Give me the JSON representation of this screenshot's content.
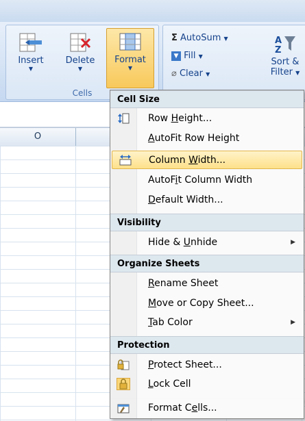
{
  "ribbon": {
    "cells_group": {
      "label": "Cells",
      "buttons": [
        {
          "label": "Insert",
          "icon": "insert-cells-icon"
        },
        {
          "label": "Delete",
          "icon": "delete-cells-icon"
        },
        {
          "label": "Format",
          "icon": "format-cells-icon"
        }
      ]
    },
    "editing_group": {
      "autosum": "AutoSum",
      "fill": "Fill",
      "clear": "Clear",
      "sort_line1": "Sort &",
      "sort_line2": "Filter"
    }
  },
  "sheet": {
    "column_header": "O"
  },
  "menu": {
    "sections": {
      "cell_size": "Cell Size",
      "visibility": "Visibility",
      "organize": "Organize Sheets",
      "protection": "Protection"
    },
    "items": {
      "row_height": {
        "pre": "Row ",
        "key": "H",
        "post": "eight..."
      },
      "autofit_row": {
        "pre": "",
        "key": "A",
        "post": "utoFit Row Height"
      },
      "column_width": {
        "pre": "Column ",
        "key": "W",
        "post": "idth..."
      },
      "autofit_col": {
        "pre": "AutoF",
        "key": "i",
        "post": "t Column Width"
      },
      "default_width": {
        "pre": "",
        "key": "D",
        "post": "efault Width..."
      },
      "hide_unhide": {
        "pre": "Hide & ",
        "key": "U",
        "post": "nhide"
      },
      "rename": {
        "pre": "",
        "key": "R",
        "post": "ename Sheet"
      },
      "move_copy": {
        "pre": "",
        "key": "M",
        "post": "ove or Copy Sheet..."
      },
      "tab_color": {
        "pre": "",
        "key": "T",
        "post": "ab Color"
      },
      "protect": {
        "pre": "",
        "key": "P",
        "post": "rotect Sheet..."
      },
      "lock": {
        "pre": "",
        "key": "L",
        "post": "ock Cell"
      },
      "format_cells": {
        "pre": "Format C",
        "key": "e",
        "post": "lls..."
      }
    },
    "highlighted_item": "Column Width..."
  },
  "colors": {
    "highlight": "#fde08a",
    "section_bg": "#dde7ee",
    "ribbon_text": "#15428b"
  }
}
